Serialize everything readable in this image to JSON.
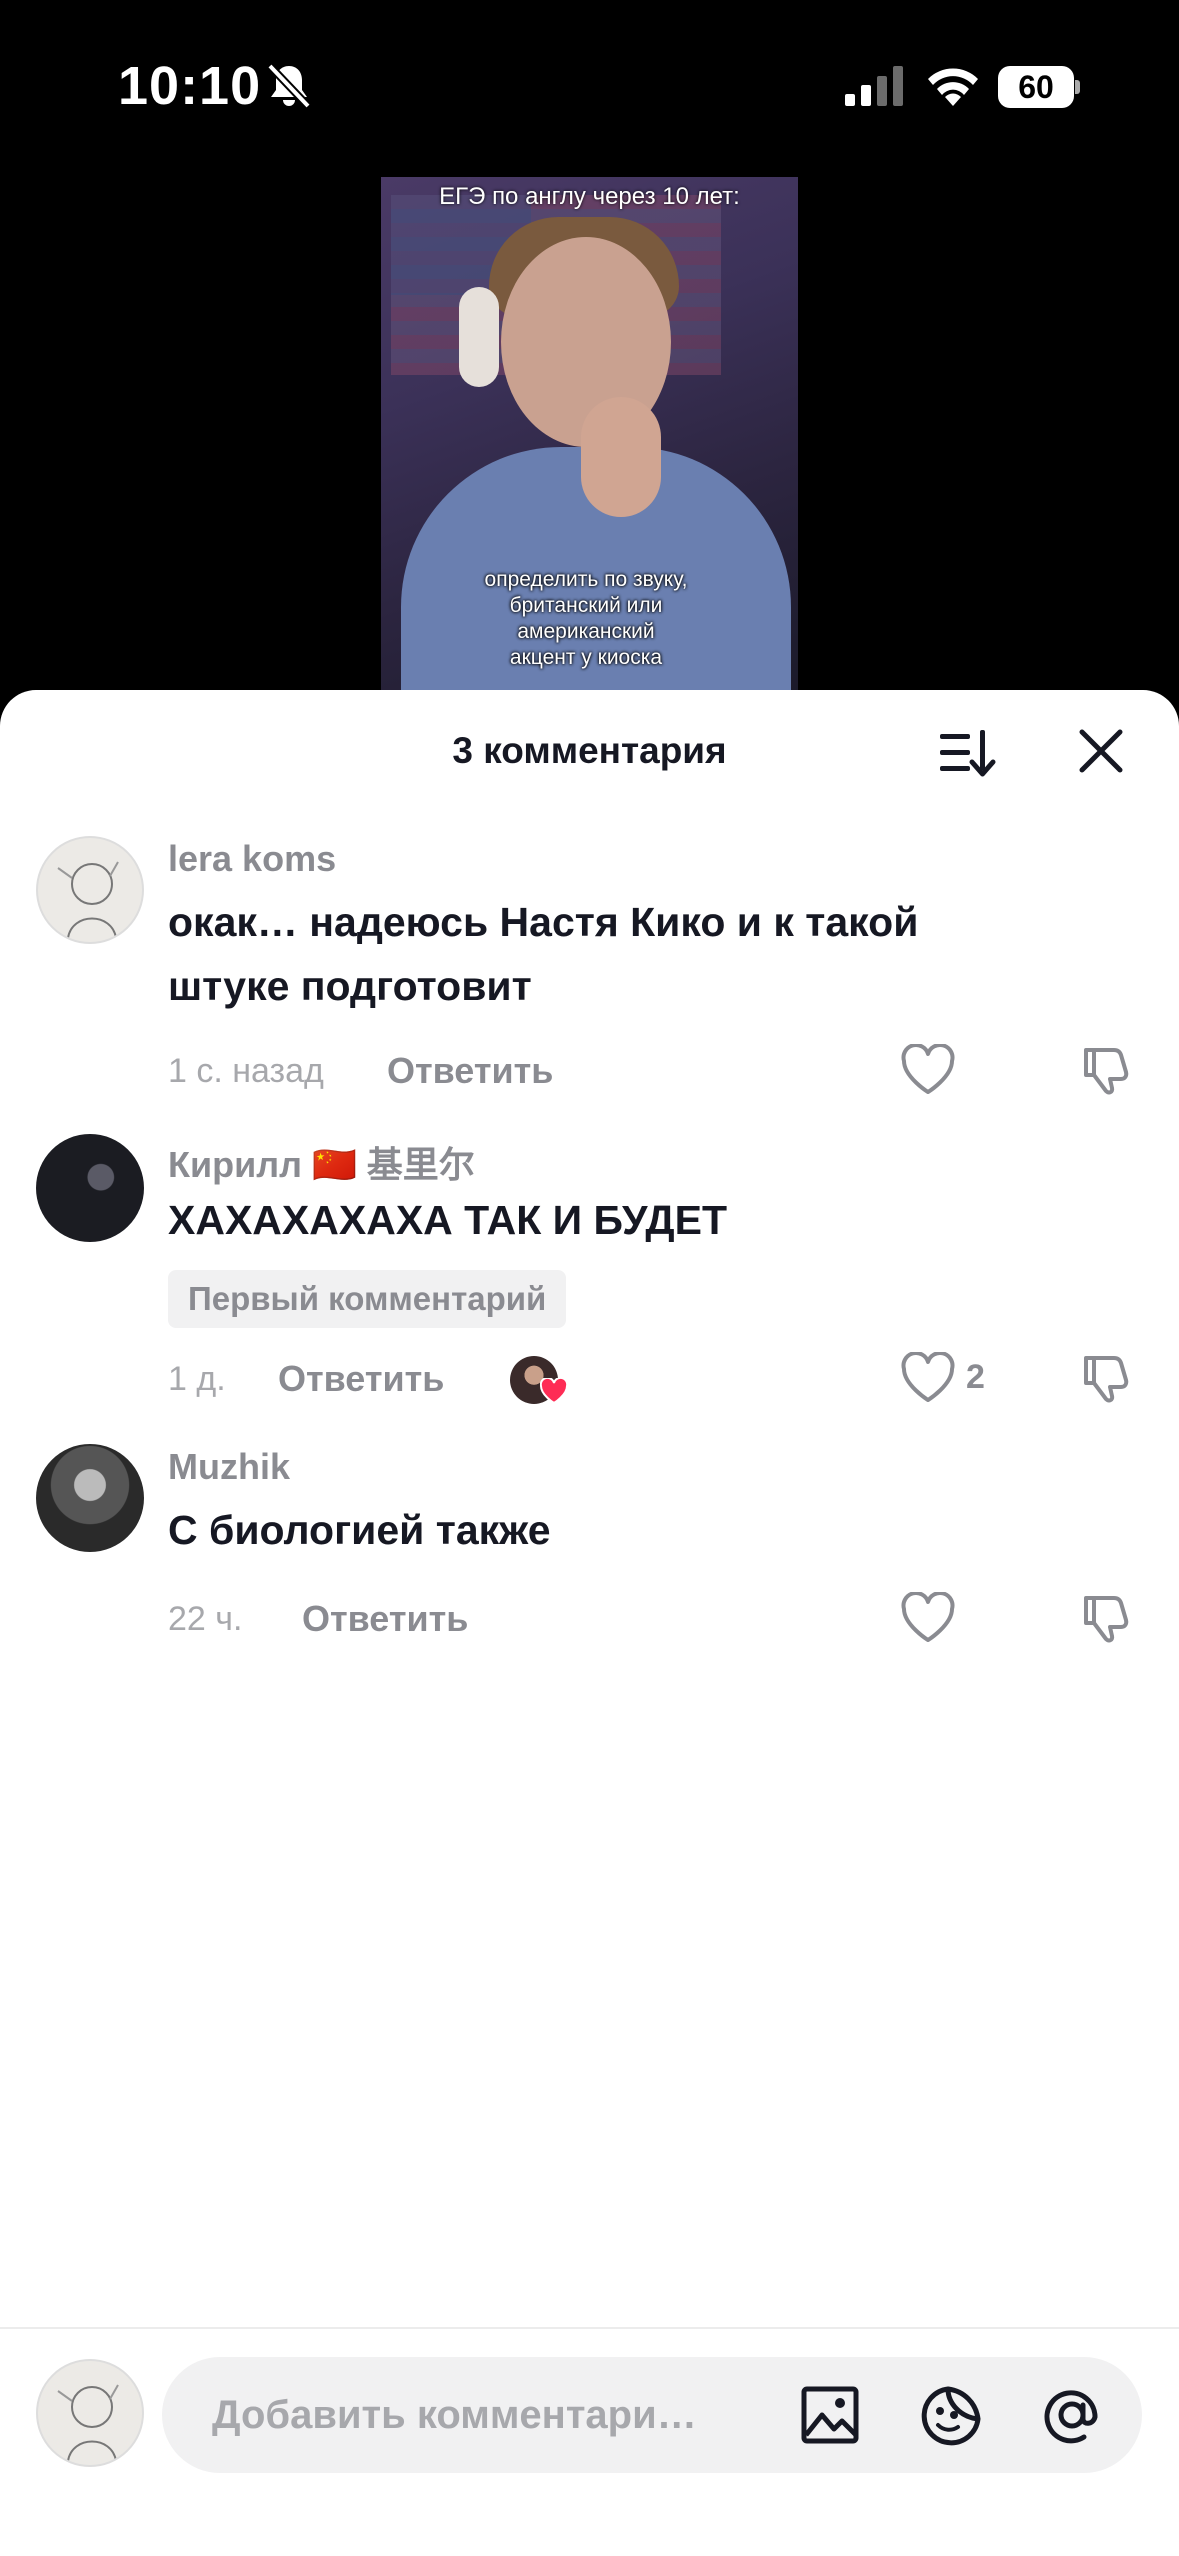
{
  "status_bar": {
    "time": "10:10",
    "battery": "60"
  },
  "video": {
    "caption_top": "ЕГЭ по англу через 10 лет:",
    "caption_mid": "определить по звуку,\nбританский или\nамериканский\nакцент у киоска"
  },
  "sheet": {
    "title": "3 комментария"
  },
  "comments": [
    {
      "username": "lera koms",
      "text": "окак… надеюсь Настя Кико и к такой штуке подготовит",
      "time": "1 с. назад",
      "reply": "Ответить",
      "likes": ""
    },
    {
      "username": "Кирилл 🇨🇳 基里尔",
      "text": "ХАХАХАХАХА ТАК И БУДЕТ",
      "badge": "Первый комментарий",
      "time": "1 д.",
      "reply": "Ответить",
      "likes": "2"
    },
    {
      "username": "Muzhik",
      "text": "С биологией также",
      "time": "22 ч.",
      "reply": "Ответить",
      "likes": ""
    }
  ],
  "input": {
    "placeholder": "Добавить комментари…"
  },
  "colors": {
    "accent_like": "#fe2c55",
    "text_primary": "#161823",
    "text_secondary": "#8a8b91"
  }
}
